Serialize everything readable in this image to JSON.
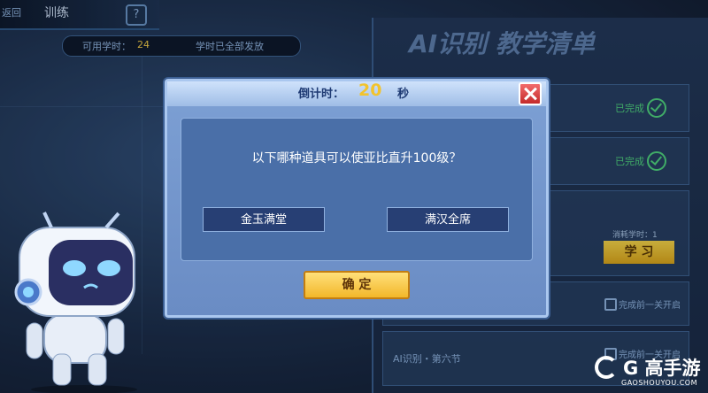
{
  "header": {
    "back_label": "返回",
    "title": "训练",
    "help_label": "?"
  },
  "hours_bar": {
    "available_label": "可用学时：",
    "available_value": "24",
    "status_text": "学时已全部发放"
  },
  "right_panel": {
    "title": "AI识别 教学清单",
    "lessons": [
      {
        "status": "已完成"
      },
      {
        "status": "已完成"
      }
    ],
    "cost_label": "消耗学时：1",
    "study_button": "学 习",
    "lock_text_1": "完成前一关开启",
    "lock_text_2": "完成前一关开启",
    "lesson_name": "AI识别・第六节"
  },
  "dialog": {
    "countdown_label": "倒计时：",
    "countdown_value": "20",
    "countdown_unit": "秒",
    "question": "以下哪种道具可以使亚比直升100级？",
    "options": [
      "金玉满堂",
      "满汉全席"
    ],
    "confirm_label": "确 定"
  },
  "watermark": {
    "name": "G 高手游",
    "url": "GAOSHOUYOU.COM"
  },
  "colors": {
    "dialog_bg": "#6a8cc4",
    "option_bg": "#273f74",
    "countdown_number": "#f2c32d",
    "confirm_button": "#f2b72a",
    "close_button": "#c42a2a",
    "completed_green": "#4fd27e"
  }
}
